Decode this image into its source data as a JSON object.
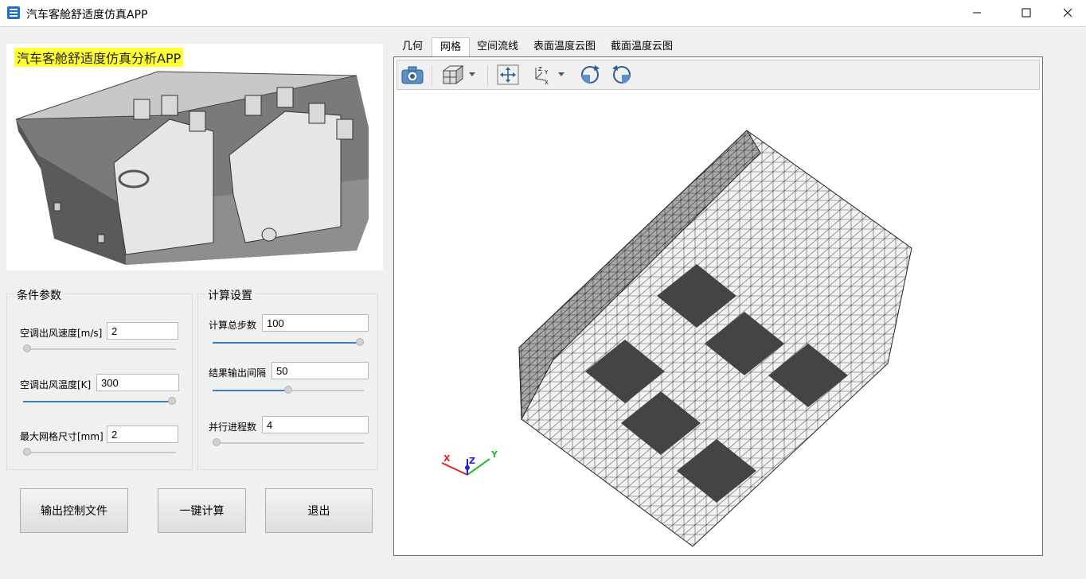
{
  "window": {
    "title": "汽车客舱舒适度仿真APP"
  },
  "hero": {
    "title": "汽车客舱舒适度仿真分析APP"
  },
  "conditions": {
    "title": "条件参数",
    "params": [
      {
        "label": "空调出风速度[m/s]",
        "value": "2",
        "slider": 0
      },
      {
        "label": "空调出风温度[K]",
        "value": "300",
        "slider": 1
      },
      {
        "label": "最大网格尺寸[mm]",
        "value": "2",
        "slider": 0
      }
    ]
  },
  "compute": {
    "title": "计算设置",
    "params": [
      {
        "label": "计算总步数",
        "value": "100",
        "slider": 1
      },
      {
        "label": "结果输出间隔",
        "value": "50",
        "slider": 0.5
      },
      {
        "label": "并行进程数",
        "value": "4",
        "slider": 0
      }
    ]
  },
  "buttons": {
    "export": "输出控制文件",
    "compute": "一键计算",
    "exit": "退出"
  },
  "tabs": [
    "几何",
    "网格",
    "空间流线",
    "表面温度云图",
    "截面温度云图"
  ],
  "active_tab": 1,
  "axes": {
    "x": "X",
    "y": "Y",
    "z": "Z"
  },
  "colors": {
    "accent": "#3a7ebf",
    "highlight": "#ffff33",
    "axis_x": "#e02020",
    "axis_y": "#20c020",
    "axis_z": "#2020e0"
  }
}
